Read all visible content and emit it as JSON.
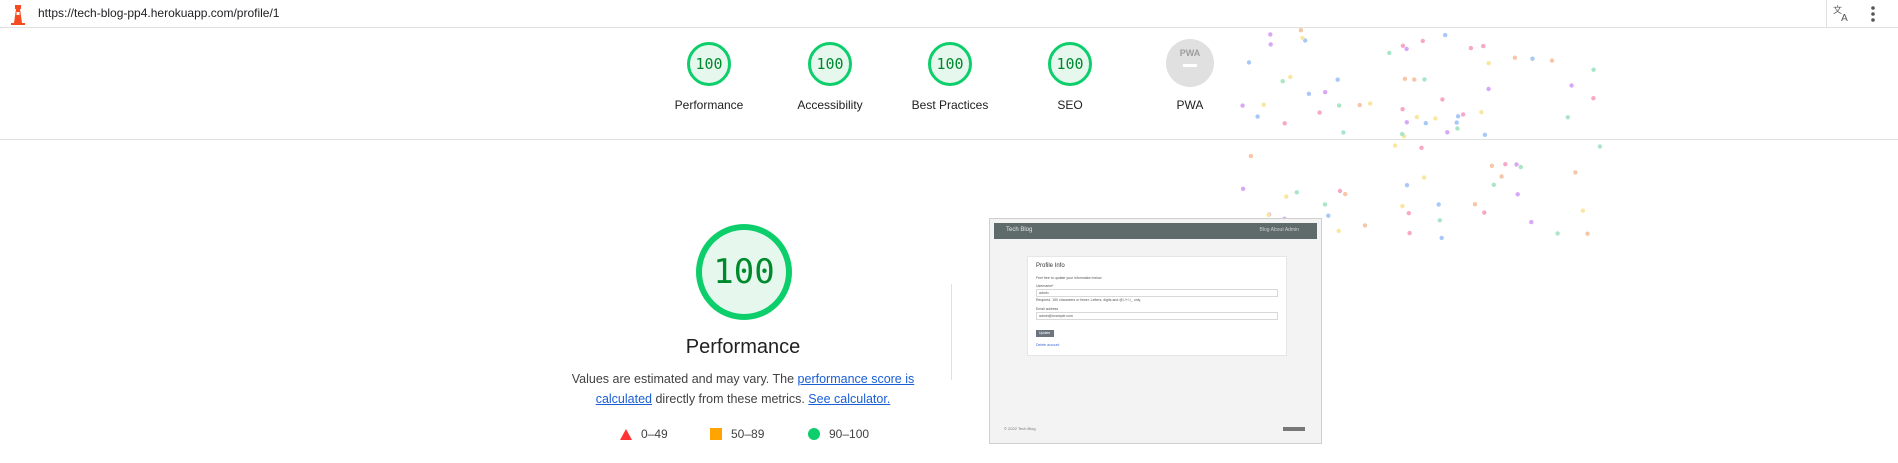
{
  "browser": {
    "url": "https://tech-blog-pp4.herokuapp.com/profile/1",
    "icons": [
      "lighthouse-logo-icon",
      "translate-icon",
      "more-vert-icon"
    ]
  },
  "categories": [
    {
      "label": "Performance",
      "score": "100"
    },
    {
      "label": "Accessibility",
      "score": "100"
    },
    {
      "label": "Best Practices",
      "score": "100"
    },
    {
      "label": "SEO",
      "score": "100"
    },
    {
      "label": "PWA",
      "badge": "PWA",
      "score": "—"
    }
  ],
  "main": {
    "score": "100",
    "title": "Performance",
    "desc_prefix": "Values are estimated and may vary. The ",
    "link1": "performance score is calculated",
    "desc_mid": " directly from these metrics. ",
    "link2": "See calculator."
  },
  "legend": {
    "fail": "0–49",
    "average": "50–89",
    "pass": "90–100"
  },
  "colors": {
    "pass": "#0cce6b",
    "average": "#ffa400",
    "fail": "#ff3333",
    "link": "#1a5fd6"
  },
  "thumbnail": {
    "brand": "Tech Blog",
    "nav": "Blog  About   Admin",
    "card_title": "Profile Info",
    "intro": "Feel free to update your information below",
    "username_label": "Username*",
    "username_value": "admin",
    "help": "Required. 150 characters or fewer. Letters, digits and @/./+/-/_ only.",
    "email_label": "Email address",
    "email_value": "admin@example.com",
    "button": "Update",
    "delete_link": "Delete account",
    "footer": "© 2022 Tech Blog"
  }
}
